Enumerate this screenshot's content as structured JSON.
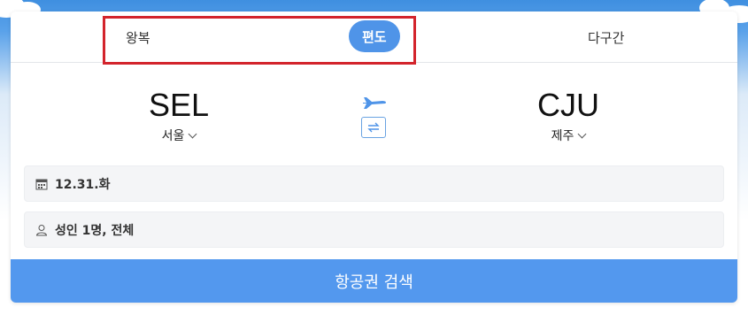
{
  "trip_tabs": {
    "roundtrip": "왕복",
    "oneway": "편도",
    "multicity": "다구간",
    "selected": "oneway"
  },
  "route": {
    "departure": {
      "code": "SEL",
      "city": "서울"
    },
    "arrival": {
      "code": "CJU",
      "city": "제주"
    },
    "plane_icon": "airplane-icon",
    "swap_icon": "swap-arrows-icon"
  },
  "date_field": {
    "icon": "calendar-icon",
    "value": "12.31.화"
  },
  "passenger_field": {
    "icon": "person-icon",
    "value": "성인 1명, 전체"
  },
  "search_button": {
    "label": "항공권 검색"
  },
  "colors": {
    "accent": "#4f94e8",
    "search_button": "#5398ee",
    "highlight_box": "#d3242c",
    "field_bg": "#f4f5f7"
  }
}
